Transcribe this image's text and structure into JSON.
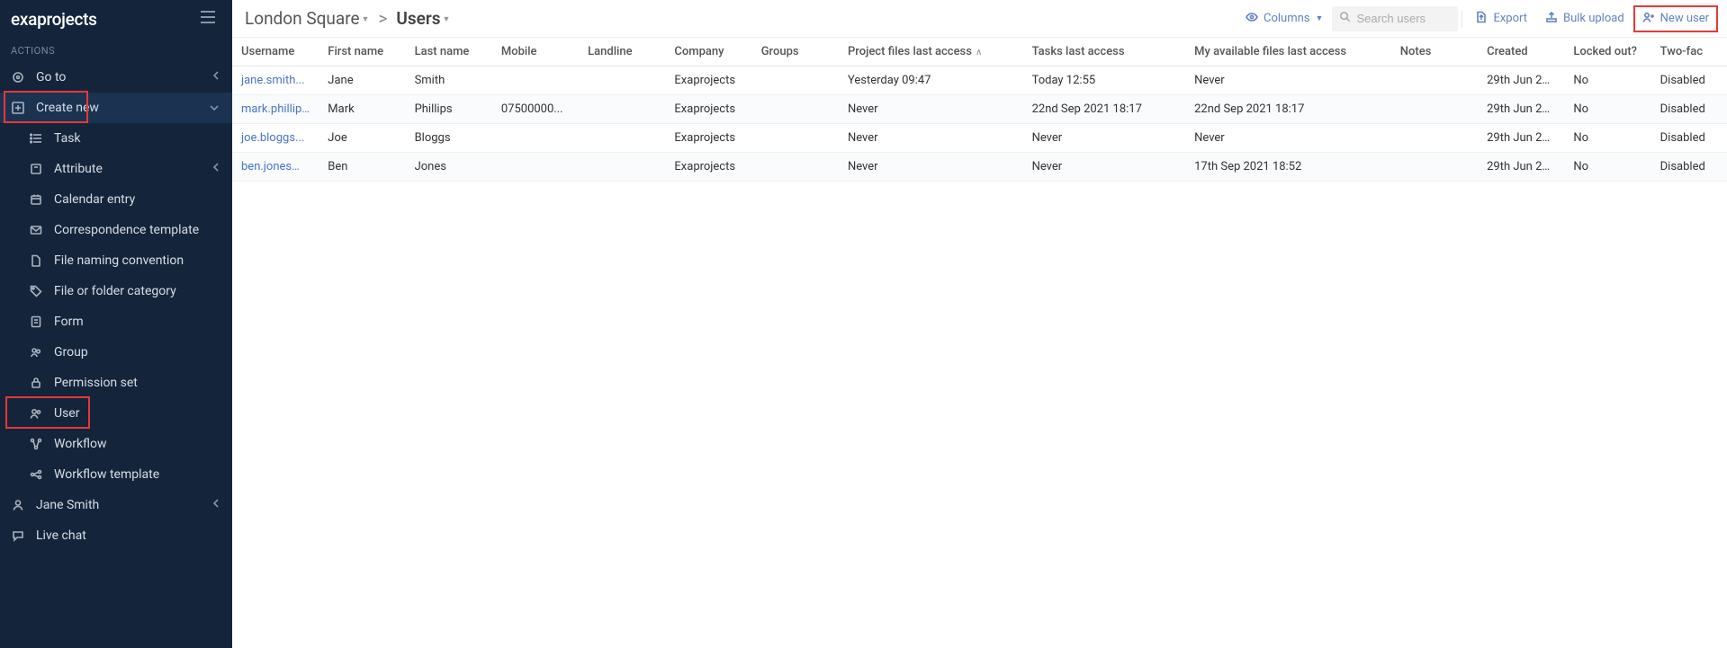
{
  "app": {
    "logo": "exaprojects"
  },
  "sidebar": {
    "section_label": "ACTIONS",
    "goto": "Go to",
    "create_new": "Create new",
    "sub": {
      "task": "Task",
      "attribute": "Attribute",
      "calendar_entry": "Calendar entry",
      "corr_template": "Correspondence template",
      "file_naming": "File naming convention",
      "file_folder_cat": "File or folder category",
      "form": "Form",
      "group": "Group",
      "perm_set": "Permission set",
      "user": "User",
      "workflow": "Workflow",
      "workflow_tpl": "Workflow template"
    },
    "user_name": "Jane Smith",
    "live_chat": "Live chat"
  },
  "breadcrumb": {
    "project": "London Square",
    "page": "Users"
  },
  "toolbar": {
    "columns": "Columns",
    "search_placeholder": "Search users",
    "export": "Export",
    "bulk_upload": "Bulk upload",
    "new_user": "New user"
  },
  "table": {
    "headers": {
      "username": "Username",
      "first_name": "First name",
      "last_name": "Last name",
      "mobile": "Mobile",
      "landline": "Landline",
      "company": "Company",
      "groups": "Groups",
      "project_files_last_access": "Project files last access",
      "tasks_last_access": "Tasks last access",
      "my_avail_files_last_access": "My available files last access",
      "notes": "Notes",
      "created": "Created",
      "locked_out": "Locked out?",
      "two_factor": "Two-fac"
    },
    "rows": [
      {
        "username": "jane.smith...",
        "first_name": "Jane",
        "last_name": "Smith",
        "mobile": "",
        "landline": "",
        "company": "Exaprojects",
        "groups": "",
        "project_files_last_access": "Yesterday 09:47",
        "tasks_last_access": "Today 12:55",
        "my_avail_files_last_access": "Never",
        "notes": "",
        "created": "29th Jun 20...",
        "locked_out": "No",
        "two_factor": "Disabled"
      },
      {
        "username": "mark.phillip...",
        "first_name": "Mark",
        "last_name": "Phillips",
        "mobile": "07500000...",
        "landline": "",
        "company": "Exaprojects",
        "groups": "",
        "project_files_last_access": "Never",
        "tasks_last_access": "22nd Sep 2021 18:17",
        "my_avail_files_last_access": "22nd Sep 2021 18:17",
        "notes": "",
        "created": "29th Jun 20...",
        "locked_out": "No",
        "two_factor": "Disabled"
      },
      {
        "username": "joe.bloggs...",
        "first_name": "Joe",
        "last_name": "Bloggs",
        "mobile": "",
        "landline": "",
        "company": "Exaprojects",
        "groups": "",
        "project_files_last_access": "Never",
        "tasks_last_access": "Never",
        "my_avail_files_last_access": "Never",
        "notes": "",
        "created": "29th Jun 20...",
        "locked_out": "No",
        "two_factor": "Disabled"
      },
      {
        "username": "ben.jones@...",
        "first_name": "Ben",
        "last_name": "Jones",
        "mobile": "",
        "landline": "",
        "company": "Exaprojects",
        "groups": "",
        "project_files_last_access": "Never",
        "tasks_last_access": "Never",
        "my_avail_files_last_access": "17th Sep 2021 18:52",
        "notes": "",
        "created": "29th Jun 20...",
        "locked_out": "No",
        "two_factor": "Disabled"
      }
    ]
  }
}
